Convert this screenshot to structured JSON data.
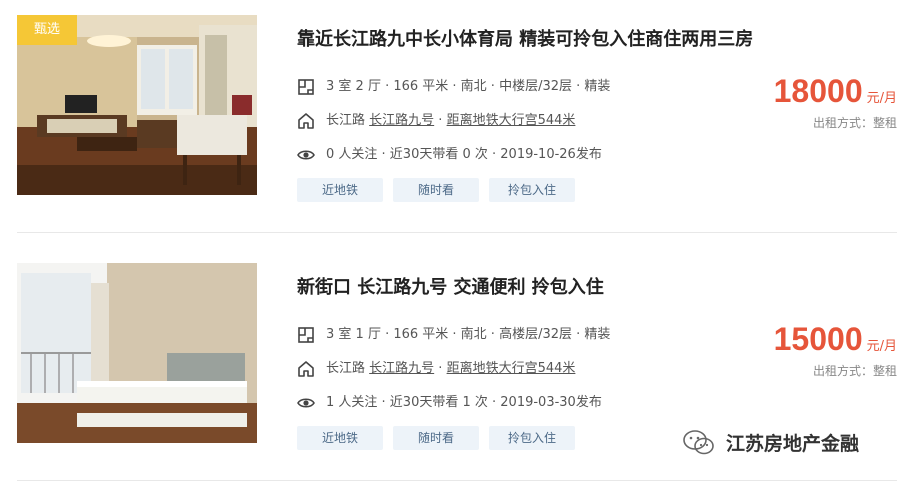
{
  "listings": [
    {
      "badge": "甄选",
      "title": "靠近长江路九中长小体育局 精装可拎包入住商住两用三房",
      "info": "3 室 2 厅 · 166 平米 · 南北 · 中楼层/32层 · 精装",
      "location": {
        "area": "长江路",
        "sep1": " ",
        "community": "长江路九号",
        "sep2": " · ",
        "metro": "距离地铁大行宫544米"
      },
      "watch": "0 人关注 · 近30天带看 0 次 · 2019-10-26发布",
      "tags": [
        "近地铁",
        "随时看",
        "拎包入住"
      ],
      "price": "18000",
      "price_unit": "元/月",
      "rent_type": "出租方式：整租"
    },
    {
      "badge": "",
      "title": "新街口 长江路九号 交通便利 拎包入住",
      "info": "3 室 1 厅 · 166 平米 · 南北 · 高楼层/32层 · 精装",
      "location": {
        "area": "长江路",
        "sep1": " ",
        "community": "长江路九号",
        "sep2": " · ",
        "metro": "距离地铁大行宫544米"
      },
      "watch": "1 人关注 · 近30天带看 1 次 · 2019-03-30发布",
      "tags": [
        "近地铁",
        "随时看",
        "拎包入住"
      ],
      "price": "15000",
      "price_unit": "元/月",
      "rent_type": "出租方式：整租"
    }
  ],
  "icons": {
    "info": "floorplan-icon",
    "location": "home-icon",
    "watch": "eye-icon",
    "watermark": "wechat-icon"
  },
  "colors": {
    "price": "#e6553a",
    "badge": "#f5c736",
    "tag_bg": "#edf3f9",
    "tag_text": "#4d6a88"
  },
  "watermark": {
    "text": "江苏房地产金融"
  }
}
